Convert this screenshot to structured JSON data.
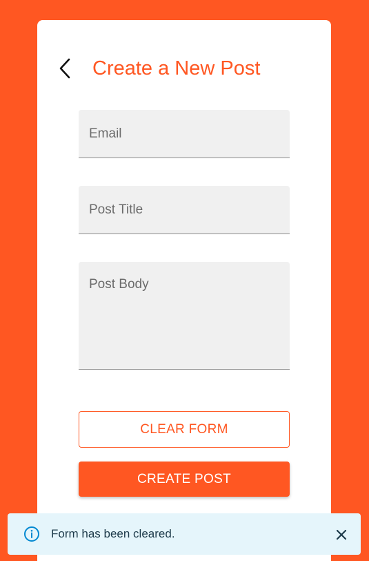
{
  "header": {
    "title": "Create a New Post",
    "back_icon": "chevron-left-icon"
  },
  "form": {
    "email_placeholder": "Email",
    "email_value": "",
    "post_title_placeholder": "Post Title",
    "post_title_value": "",
    "post_body_placeholder": "Post Body",
    "post_body_value": ""
  },
  "buttons": {
    "clear_label": "CLEAR FORM",
    "create_label": "CREATE POST"
  },
  "toast": {
    "message": "Form has been cleared.",
    "info_icon": "info-circle-icon",
    "close_icon": "close-icon"
  },
  "colors": {
    "brand": "#ff5722",
    "card": "#ffffff",
    "field_bg": "#f0f0f0",
    "toast_bg": "#e5f5fb",
    "toast_icon": "#0288d1"
  }
}
